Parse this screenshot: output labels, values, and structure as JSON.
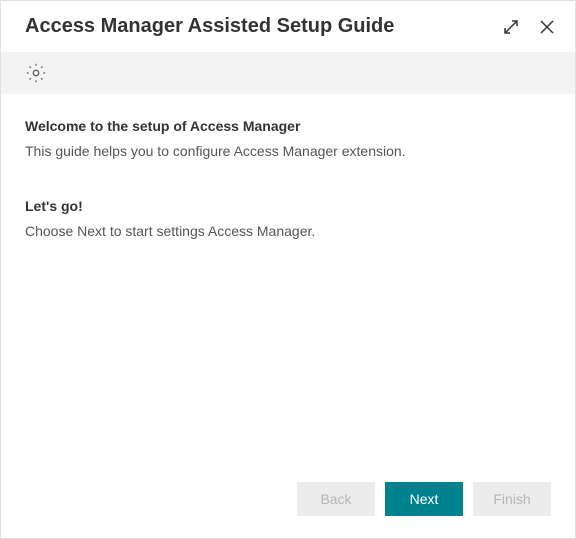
{
  "titlebar": {
    "title": "Access Manager Assisted Setup Guide"
  },
  "content": {
    "sections": [
      {
        "heading": "Welcome to the setup of Access Manager",
        "body": "This guide helps you to configure Access Manager extension."
      },
      {
        "heading": "Let's go!",
        "body": "Choose Next to start settings Access Manager."
      }
    ]
  },
  "footer": {
    "back_label": "Back",
    "next_label": "Next",
    "finish_label": "Finish"
  }
}
